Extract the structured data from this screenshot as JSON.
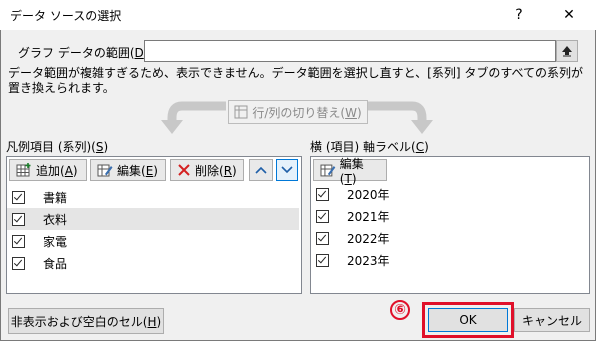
{
  "window": {
    "title": "データ ソースの選択",
    "help_label": "?",
    "close_label": "✕"
  },
  "chart_range": {
    "label_pre": "グラフ データの範囲(",
    "label_key": "D",
    "label_post": "):",
    "value": ""
  },
  "message": "データ範囲が複雑すぎるため、表示できません。データ範囲を選択し直すと、[系列] タブのすべての系列が置き換えられます。",
  "switch_button": {
    "pre": "行/列の切り替え(",
    "key": "W",
    "post": ")"
  },
  "legend_panel": {
    "label_pre": "凡例項目 (系列)(",
    "label_key": "S",
    "label_post": ")",
    "add": {
      "pre": "追加(",
      "key": "A",
      "post": ")"
    },
    "edit": {
      "pre": "編集(",
      "key": "E",
      "post": ")"
    },
    "delete": {
      "pre": "削除(",
      "key": "R",
      "post": ")"
    },
    "items": [
      {
        "label": "書籍",
        "checked": true
      },
      {
        "label": "衣料",
        "checked": true
      },
      {
        "label": "家電",
        "checked": true
      },
      {
        "label": "食品",
        "checked": true
      }
    ]
  },
  "axis_panel": {
    "label_pre": "横 (項目) 軸ラベル(",
    "label_key": "C",
    "label_post": ")",
    "edit": {
      "pre": "編集(",
      "key": "T",
      "post": ")"
    },
    "items": [
      {
        "label": "2020年",
        "checked": true
      },
      {
        "label": "2021年",
        "checked": true
      },
      {
        "label": "2022年",
        "checked": true
      },
      {
        "label": "2023年",
        "checked": true
      }
    ]
  },
  "hidden_cells_button": {
    "pre": "非表示および空白のセル(",
    "key": "H",
    "post": ")"
  },
  "ok_label": "OK",
  "cancel_label": "キャンセル",
  "step_badge": "⑥",
  "colors": {
    "highlight": "#e0102a",
    "selected_row": "#e5e5e5"
  }
}
